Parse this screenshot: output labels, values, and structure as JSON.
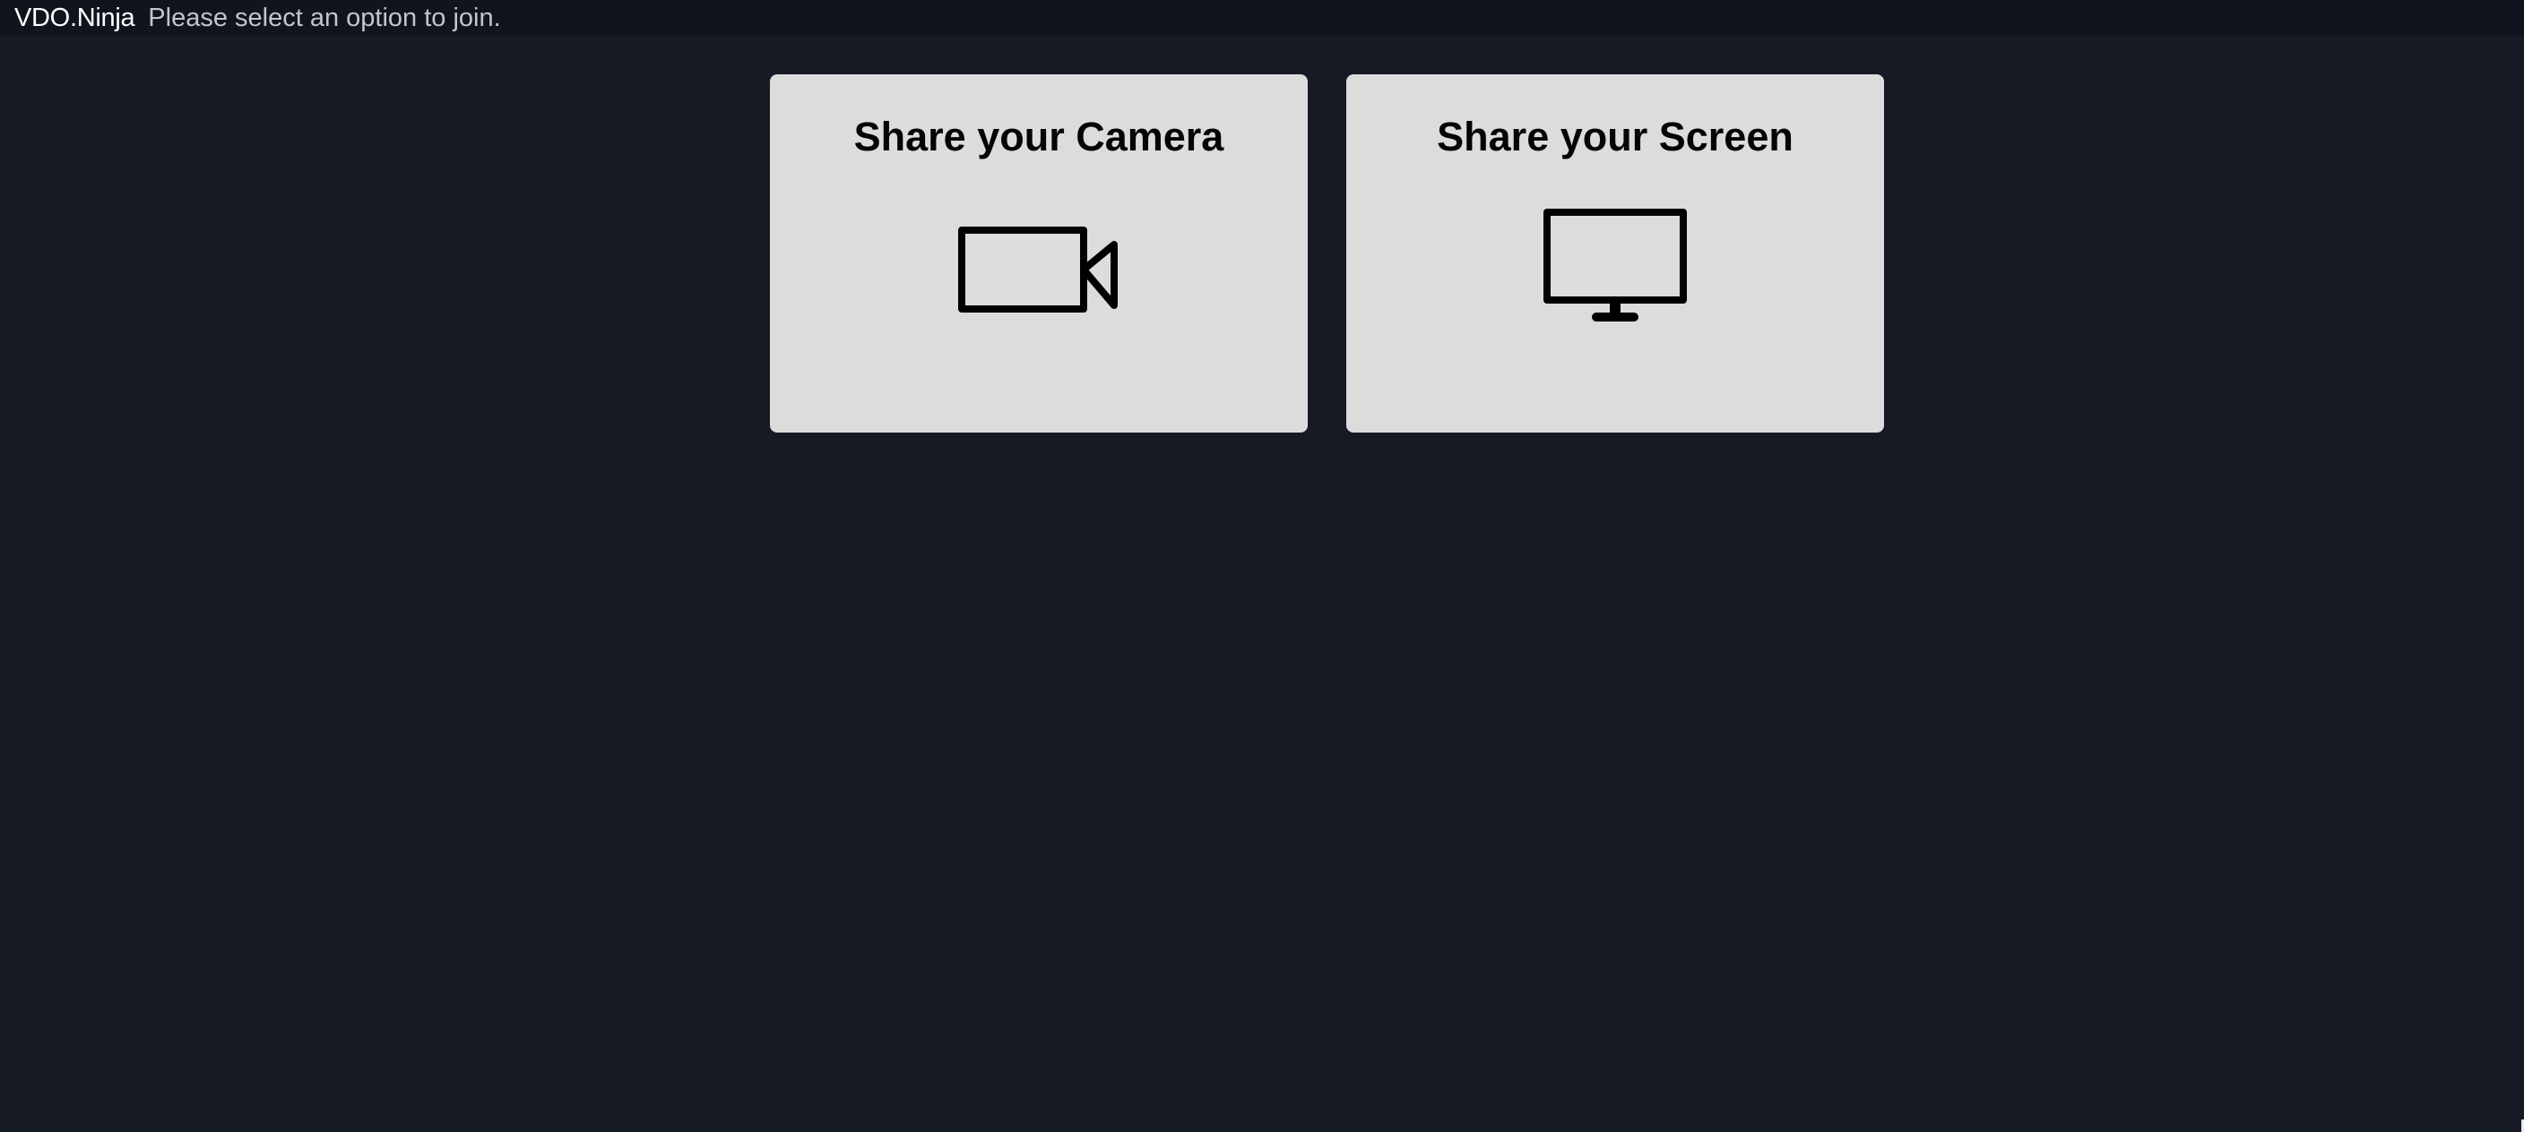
{
  "header": {
    "brand": "VDO.Ninja",
    "status": "Please select an option to join."
  },
  "options": [
    {
      "title": "Share your Camera",
      "icon": "video-camera-icon"
    },
    {
      "title": "Share your Screen",
      "icon": "monitor-icon"
    }
  ],
  "colors": {
    "page_background": "#161a25",
    "header_background": "#10141d",
    "card_background": "#dcdcdc",
    "icon_color": "#000000"
  }
}
